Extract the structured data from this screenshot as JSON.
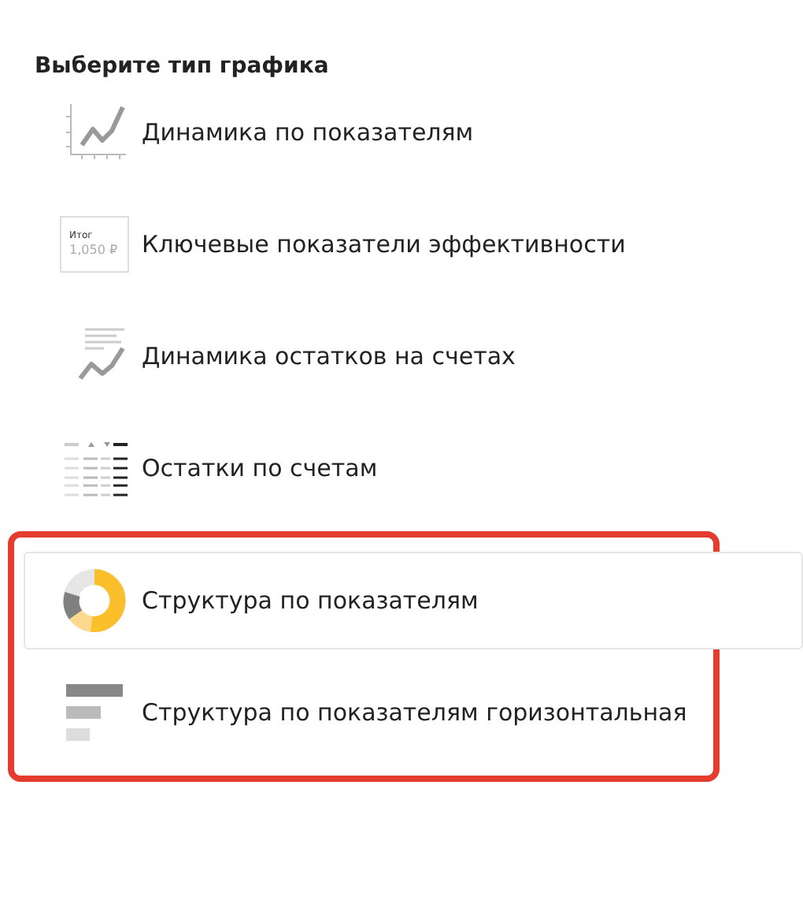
{
  "title": "Выберите тип графика",
  "items": [
    {
      "kind": "line",
      "label": "Динамика по показателям",
      "hovered": false,
      "highlighted": false
    },
    {
      "kind": "kpi",
      "label": "Ключевые показатели эффективности",
      "caption": "Итог",
      "value": "1,050 ₽",
      "hovered": false,
      "highlighted": false
    },
    {
      "kind": "balance",
      "label": "Динамика остатков на счетах",
      "hovered": false,
      "highlighted": false
    },
    {
      "kind": "table",
      "label": "Остатки по счетам",
      "hovered": false,
      "highlighted": false
    },
    {
      "kind": "donut",
      "label": "Структура по показателям",
      "hovered": true,
      "highlighted": true
    },
    {
      "kind": "hbar",
      "label": "Структура по показателям горизонтальная",
      "hovered": false,
      "highlighted": true
    }
  ]
}
